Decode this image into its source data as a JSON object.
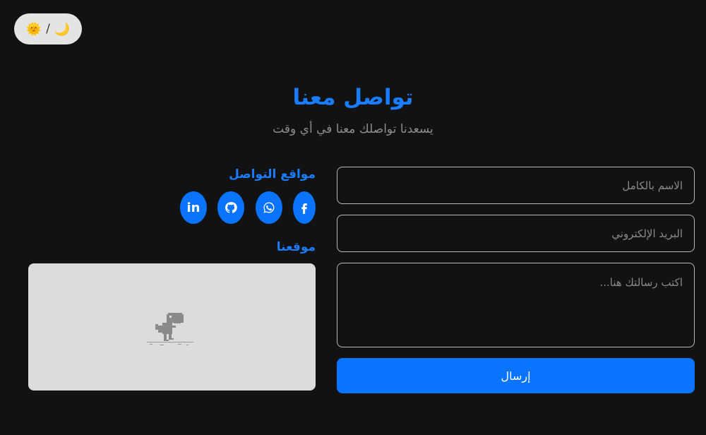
{
  "theme_toggle": {
    "sun_glyph": "🌞",
    "separator": "/",
    "moon_glyph": "🌙"
  },
  "header": {
    "title": "تواصل معنا",
    "subtitle": "يسعدنا تواصلك معنا في أي وقت"
  },
  "form": {
    "name_placeholder": "الاسم بالكامل",
    "email_placeholder": "البريد الإلكتروني",
    "message_placeholder": "اكتب رسالتك هنا...",
    "submit_label": "إرسال"
  },
  "social": {
    "heading": "مواقع التواصل",
    "icons": [
      "facebook-icon",
      "whatsapp-icon",
      "github-icon",
      "linkedin-icon"
    ],
    "linkedin_label": "in"
  },
  "location": {
    "heading": "موقعنا"
  },
  "colors": {
    "background": "#121212",
    "accent": "#0a74ff",
    "heading": "#1a7cff",
    "muted_text": "#8d8d8d"
  }
}
